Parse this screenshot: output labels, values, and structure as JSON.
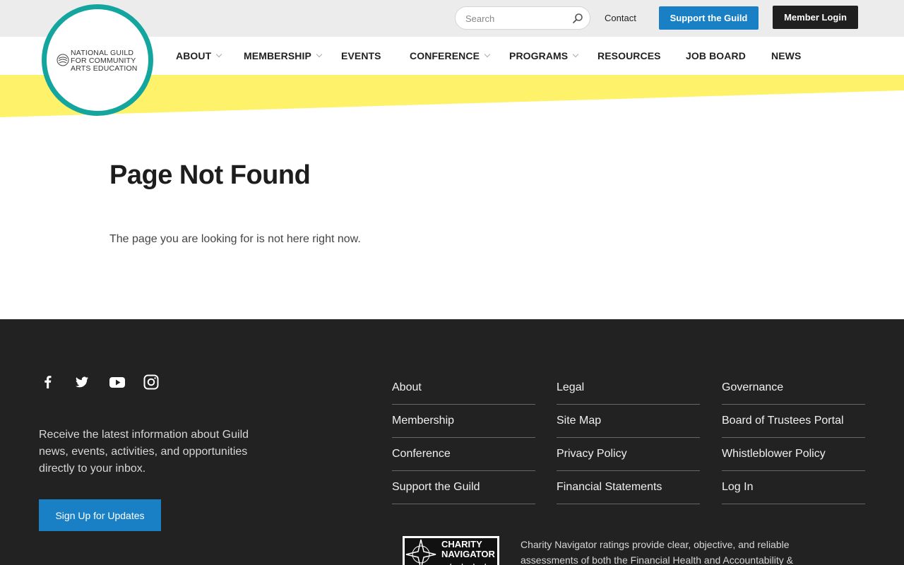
{
  "topbar": {
    "search_placeholder": "Search",
    "contact_label": "Contact",
    "support_label": "Support the Guild",
    "login_label": "Member Login"
  },
  "logo": {
    "line1": "NATIONAL GUILD",
    "line2": "FOR COMMUNITY",
    "line3": "ARTS EDUCATION"
  },
  "nav": {
    "items": [
      {
        "label": "ABOUT"
      },
      {
        "label": "MEMBERSHIP"
      },
      {
        "label": "EVENTS"
      },
      {
        "label": "CONFERENCE"
      },
      {
        "label": "PROGRAMS"
      },
      {
        "label": "RESOURCES"
      },
      {
        "label": "JOB BOARD"
      },
      {
        "label": "NEWS"
      }
    ]
  },
  "main": {
    "title": "Page Not Found",
    "message": "The page you are looking for is not here right now."
  },
  "footer": {
    "newsletter_text": "Receive the latest information about Guild news, events, activities, and opportunities directly to your inbox.",
    "signup_label": "Sign Up for Updates",
    "col1": [
      "About",
      "Membership",
      "Conference",
      "Support the Guild"
    ],
    "col2": [
      "Legal",
      "Site Map",
      "Privacy Policy",
      "Financial Statements"
    ],
    "col3": [
      "Governance",
      "Board of Trustees Portal",
      "Whistleblower Policy",
      "Log In"
    ],
    "charity_badge_line1": "CHARITY",
    "charity_badge_line2": "NAVIGATOR",
    "charity_text": "Charity Navigator ratings provide clear, objective, and reliable assessments of both the Financial Health and Accountability &"
  },
  "colors": {
    "accent_blue": "#1a80c5",
    "teal": "#14a59f",
    "yellow": "#fff26b",
    "footer_bg": "#222222"
  }
}
